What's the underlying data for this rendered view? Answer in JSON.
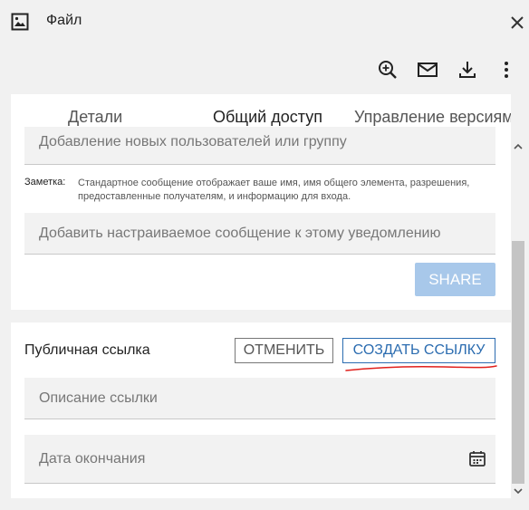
{
  "window": {
    "title": "Файл",
    "icons": {
      "file": "image-icon",
      "close": "close-icon"
    }
  },
  "toolbar": {
    "icons": [
      "zoom-in-icon",
      "mail-icon",
      "download-icon",
      "more-vert-icon"
    ]
  },
  "tabs": [
    {
      "label": "Детали",
      "active": false
    },
    {
      "label": "Общий доступ",
      "active": true
    },
    {
      "label": "Управление версиями",
      "active": false
    }
  ],
  "sharing": {
    "users_placeholder": "Добавление новых пользователей или группу",
    "note_label": "Заметка:",
    "note_text": "Стандартное сообщение отображает ваше имя, имя общего элемента, разрешения, предоставленные получателям, и информацию для входа.",
    "message_placeholder": "Добавить настраиваемое сообщение к этому уведомлению",
    "share_label": "SHARE"
  },
  "public_link": {
    "label": "Публичная ссылка",
    "cancel_label": "ОТМЕНИТЬ",
    "create_label": "СОЗДАТЬ ССЫЛКУ",
    "description_placeholder": "Описание ссылки",
    "expiry_placeholder": "Дата окончания"
  },
  "colors": {
    "accent": "#2b6cb0",
    "share_disabled": "#a8c8ea",
    "annotation": "#e0201c"
  }
}
